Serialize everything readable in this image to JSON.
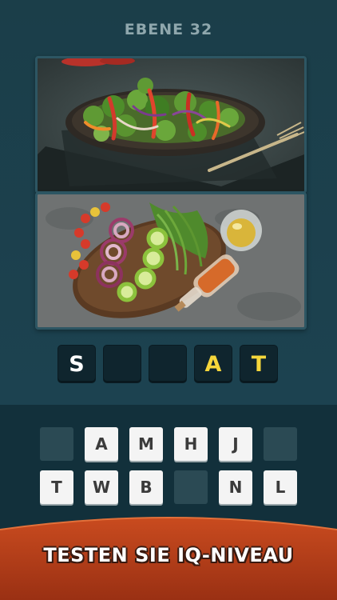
{
  "level": {
    "title": "EBENE 32"
  },
  "photos": [
    {
      "name": "salad-photo"
    },
    {
      "name": "vegetables-photo"
    }
  ],
  "answer_slots": [
    {
      "letter": "S",
      "color": "white"
    },
    {
      "letter": "",
      "color": "white"
    },
    {
      "letter": "",
      "color": "white"
    },
    {
      "letter": "A",
      "color": "yellow"
    },
    {
      "letter": "T",
      "color": "yellow"
    }
  ],
  "keyboard": {
    "row1": [
      "",
      "A",
      "M",
      "H",
      "J",
      ""
    ],
    "row2": [
      "T",
      "W",
      "B",
      "",
      "N",
      "L"
    ]
  },
  "banner": {
    "text": "TESTEN SIE IQ-NIVEAU"
  },
  "colors": {
    "background": "#1b3e49",
    "answer_highlight": "#f5d63b",
    "banner": "#b5401b"
  }
}
